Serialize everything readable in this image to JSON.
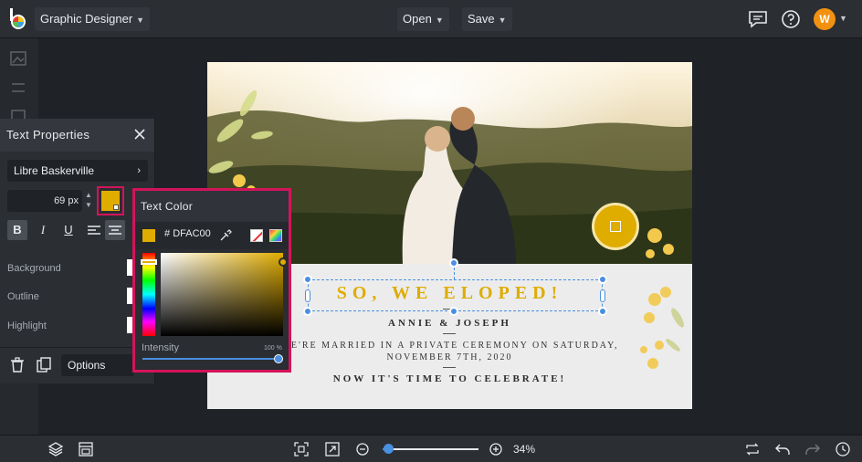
{
  "header": {
    "workspace_label": "Graphic Designer",
    "open_label": "Open",
    "save_label": "Save",
    "avatar_initial": "W",
    "icons": [
      "befunky-logo-icon",
      "chat-icon",
      "help-icon"
    ]
  },
  "text_properties": {
    "title": "Text Properties",
    "font_family": "Libre Baskerville",
    "font_size": "69",
    "font_size_unit": "px",
    "color_hex": "#DFAC00",
    "format_buttons": [
      {
        "name": "bold-button",
        "label": "B",
        "active": true
      },
      {
        "name": "italic-button",
        "label": "I",
        "active": false
      },
      {
        "name": "underline-button",
        "label": "U",
        "active": false
      }
    ],
    "background_label": "Background",
    "outline_label": "Outline",
    "highlight_label": "Highlight",
    "options_label": "Options"
  },
  "text_color": {
    "title": "Text Color",
    "hex_prefix": "#",
    "hex_value": "DFAC00",
    "intensity_label": "Intensity",
    "intensity_value": "100 %",
    "intensity": 1.0
  },
  "design": {
    "headline": "SO, WE ELOPED!",
    "names": "ANNIE & JOSEPH",
    "body_line1": "WE'RE MARRIED IN A PRIVATE CEREMONY ON SATURDAY,",
    "body_line2": "NOVEMBER 7TH, 2020",
    "celebrate": "NOW IT'S TIME TO CELEBRATE!",
    "text_color": "#DFAC00"
  },
  "bottom_bar": {
    "zoom_value": "34%",
    "zoom_fraction": 0.06
  }
}
